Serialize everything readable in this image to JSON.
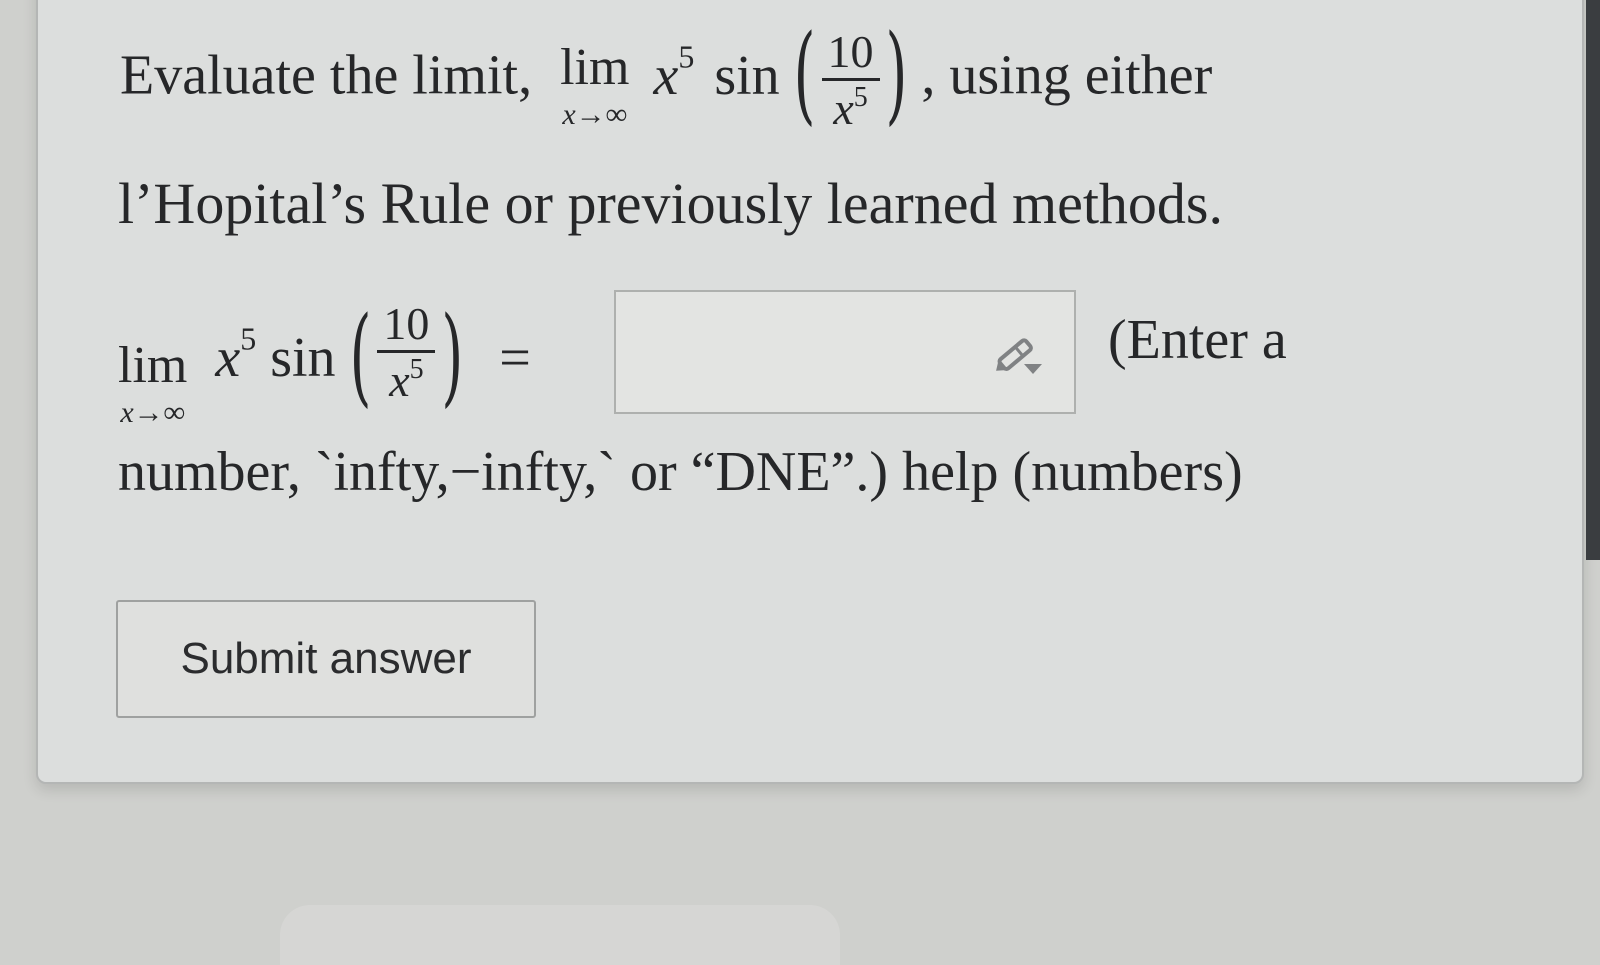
{
  "question": {
    "intro": "Evaluate the limit,",
    "lim_word": "lim",
    "lim_sub": "x→∞",
    "base": "x",
    "exponent": "5",
    "func": "sin",
    "frac_num": "10",
    "frac_den_base": "x",
    "frac_den_exp": "5",
    "after": ", using either",
    "line2": "l’Hopital’s Rule or previously learned methods."
  },
  "answer": {
    "equals": "=",
    "value": "",
    "placeholder": "",
    "hint_part1": "(Enter a",
    "hint_part2": "number, `infty,−infty,` or “DNE”.)",
    "help_label": "help (numbers)"
  },
  "submit": {
    "label": "Submit answer"
  },
  "icons": {
    "editor": "pencil-icon"
  }
}
